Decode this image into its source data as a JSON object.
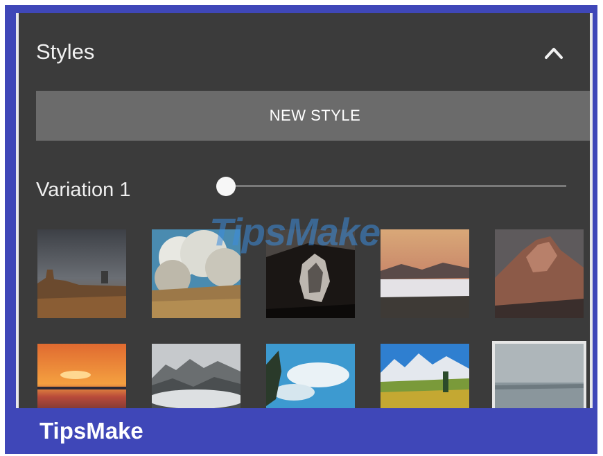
{
  "panel": {
    "title": "Styles",
    "collapse_icon": "chevron-up-icon",
    "new_style_label": "NEW STYLE",
    "variation_label": "Variation 1",
    "variation_value": 0,
    "thumbnails": [
      {
        "name": "desert-storm"
      },
      {
        "name": "clouds-grassland"
      },
      {
        "name": "dark-cave-arch"
      },
      {
        "name": "sunset-fog-valley"
      },
      {
        "name": "rocky-peak"
      },
      {
        "name": "orange-sunset-sea"
      },
      {
        "name": "misty-forest-hills"
      },
      {
        "name": "blue-sky-trees"
      },
      {
        "name": "alpine-meadow"
      },
      {
        "name": "calm-lake",
        "selected": true
      }
    ]
  },
  "watermark": "TipsMake",
  "footer": {
    "brand": "TipsMake"
  },
  "colors": {
    "frame": "#3f47b8",
    "panel": "#3b3b3b",
    "button": "#6b6b6b"
  }
}
